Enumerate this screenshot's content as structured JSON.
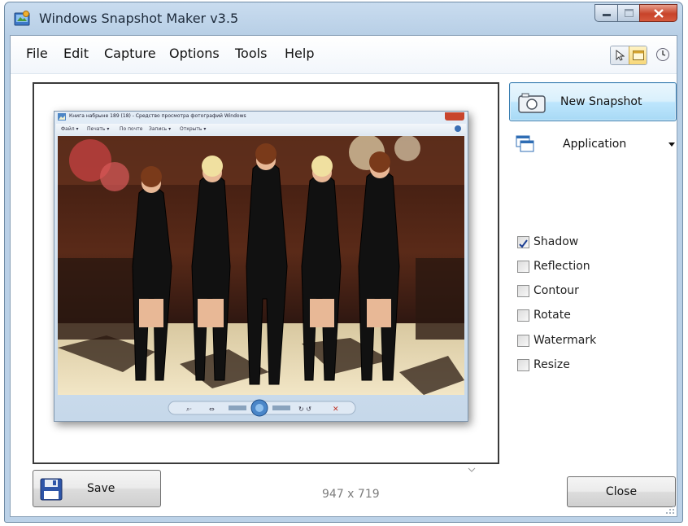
{
  "window": {
    "title": "Windows Snapshot Maker v3.5"
  },
  "menu": {
    "items": [
      "File",
      "Edit",
      "Capture",
      "Options",
      "Tools",
      "Help"
    ]
  },
  "toolbar": {
    "icons": [
      "cursor-icon",
      "window-icon",
      "clock-icon"
    ],
    "selected": "window-icon"
  },
  "preview": {
    "inner_title": "Книга набрыне 189 (18) - Средство просмотра фотографий Windows",
    "inner_menu": [
      "Файл ▾",
      "Печать ▾",
      "По почте",
      "Запись ▾",
      "Открыть ▾"
    ]
  },
  "actions": {
    "new_snapshot": "New Snapshot",
    "source": "Application",
    "save": "Save",
    "close": "Close"
  },
  "options": [
    {
      "label": "Shadow",
      "checked": true
    },
    {
      "label": "Reflection",
      "checked": false
    },
    {
      "label": "Contour",
      "checked": false
    },
    {
      "label": "Rotate",
      "checked": false
    },
    {
      "label": "Watermark",
      "checked": false
    },
    {
      "label": "Resize",
      "checked": false
    }
  ],
  "status": {
    "dimensions": "947 x 719"
  },
  "colors": {
    "frame": "#bcd2e8",
    "accent_button": "#bee6fd",
    "close_button": "#c7432a",
    "checkmark": "#1c3f94"
  }
}
